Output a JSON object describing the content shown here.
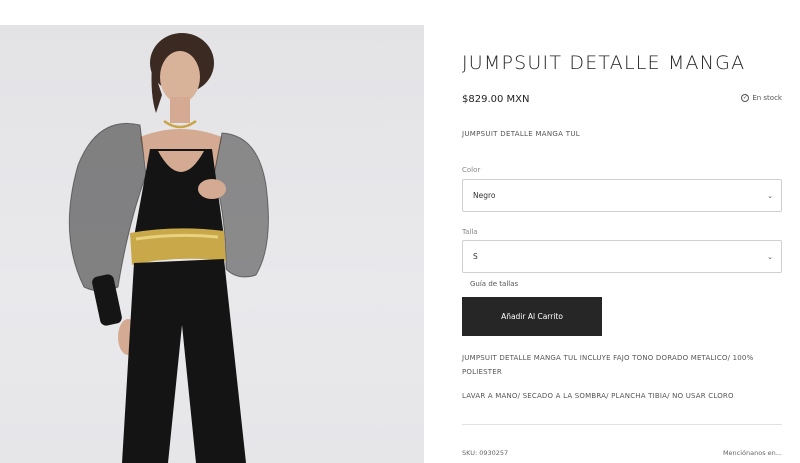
{
  "product": {
    "title": "JUMPSUIT DETALLE MANGA",
    "price": "$829.00 MXN",
    "stock": "En stock",
    "subtitle": "JUMPSUIT DETALLE MANGA TUL",
    "image_alt": "model-wearing-black-jumpsuit"
  },
  "options": {
    "color_label": "Color",
    "color_value": "Negro",
    "size_label": "Talla",
    "size_value": "S",
    "size_guide": "Guía de tallas"
  },
  "actions": {
    "add_to_cart": "Añadir Al Carrito"
  },
  "details": {
    "description": "JUMPSUIT DETALLE MANGA TUL INCLUYE FAJO TONO DORADO METALICO/ 100% POLIESTER",
    "care": "LAVAR A MANO/ SECADO A LA SOMBRA/ PLANCHA TIBIA/ NO USAR CLORO"
  },
  "footer": {
    "sku": "SKU: 0930257",
    "mentions": "Menciónanos en..."
  },
  "colors": {
    "button_bg": "#262626",
    "photo_bg": "#e6e6e9",
    "belt_gold": "#c9a84a"
  },
  "icons": [
    "check-circle-icon",
    "chevron-down-icon"
  ]
}
